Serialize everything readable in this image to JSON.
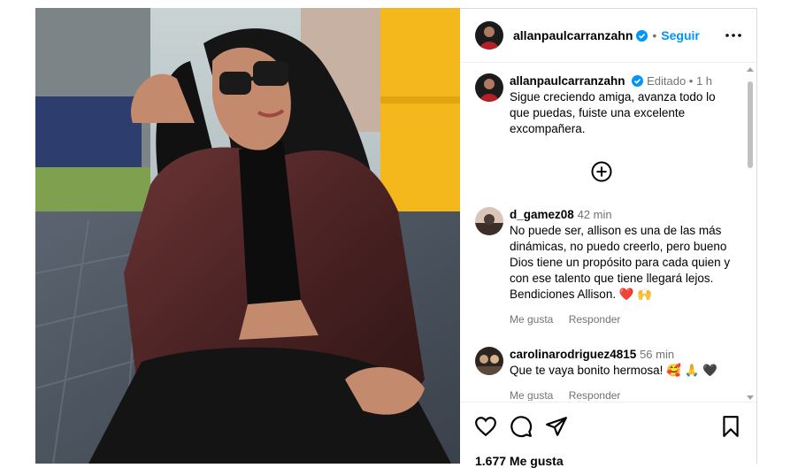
{
  "post": {
    "author": "allanpaulcarranzahn",
    "follow_label": "Seguir",
    "caption": {
      "author": "allanpaulcarranzahn",
      "edited_label": "Editado",
      "time": "1 h",
      "text": "Sigue creciendo amiga, avanza todo lo que puedas, fuiste una excelente excompañera."
    },
    "comments": [
      {
        "user": "d_gamez08",
        "time": "42 min",
        "text": "No puede ser, allison es una de las más dinámicas, no puedo creerlo, pero bueno Dios tiene un propósito para cada quien y con ese talento que tiene llegará lejos. Bendiciones Allison. ❤️ 🙌",
        "like_label": "Me gusta",
        "reply_label": "Responder"
      },
      {
        "user": "carolinarodriguez4815",
        "time": "56 min",
        "text": "Que te vaya bonito hermosa! 🥰 🙏 🖤",
        "like_label": "Me gusta",
        "reply_label": "Responder"
      }
    ],
    "likes": "1.677 Me gusta"
  },
  "icons": {
    "verified": "verified-badge-icon",
    "more": "more-options-icon",
    "load_more": "plus-circle-icon",
    "like": "heart-icon",
    "comment": "comment-icon",
    "share": "paper-plane-icon",
    "save": "bookmark-icon"
  },
  "colors": {
    "accent": "#0095f6",
    "secondary_text": "#737373",
    "photo_wall": "#f5b81c",
    "jacket": "#5a2a2a"
  }
}
